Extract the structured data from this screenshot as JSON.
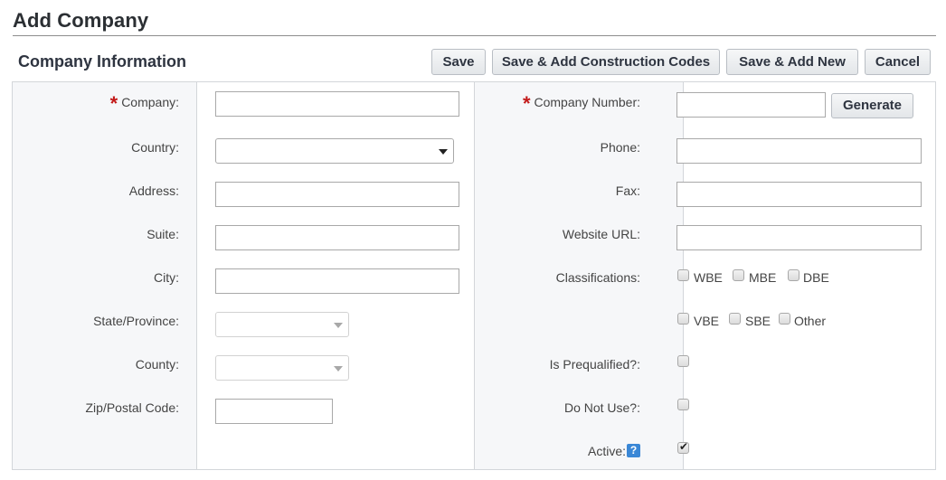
{
  "page": {
    "title": "Add Company"
  },
  "section": {
    "title": "Company Information"
  },
  "toolbar": {
    "save_label": "Save",
    "save_add_codes_label": "Save & Add Construction Codes",
    "save_add_new_label": "Save & Add New",
    "cancel_label": "Cancel"
  },
  "form": {
    "left": {
      "company": {
        "label": "Company:",
        "required": true,
        "value": ""
      },
      "country": {
        "label": "Country:",
        "value": ""
      },
      "address": {
        "label": "Address:",
        "value": ""
      },
      "suite": {
        "label": "Suite:",
        "value": ""
      },
      "city": {
        "label": "City:",
        "value": ""
      },
      "state": {
        "label": "State/Province:",
        "value": ""
      },
      "county": {
        "label": "County:",
        "value": ""
      },
      "zip": {
        "label": "Zip/Postal Code:",
        "value": ""
      }
    },
    "right": {
      "company_number": {
        "label": "Company Number:",
        "required": true,
        "value": "",
        "generate_label": "Generate"
      },
      "phone": {
        "label": "Phone:",
        "value": ""
      },
      "fax": {
        "label": "Fax:",
        "value": ""
      },
      "website": {
        "label": "Website URL:",
        "value": ""
      },
      "classifications": {
        "label": "Classifications:",
        "options": [
          {
            "label": "WBE",
            "checked": false
          },
          {
            "label": "MBE",
            "checked": false
          },
          {
            "label": "DBE",
            "checked": false
          },
          {
            "label": "VBE",
            "checked": false
          },
          {
            "label": "SBE",
            "checked": false
          },
          {
            "label": "Other",
            "checked": false
          }
        ]
      },
      "prequalified": {
        "label": "Is Prequalified?:",
        "checked": false
      },
      "do_not_use": {
        "label": "Do Not Use?:",
        "checked": false
      },
      "active": {
        "label": "Active:",
        "checked": true,
        "help_glyph": "?"
      }
    }
  },
  "required_marker": "*",
  "check_glyph": "✔"
}
